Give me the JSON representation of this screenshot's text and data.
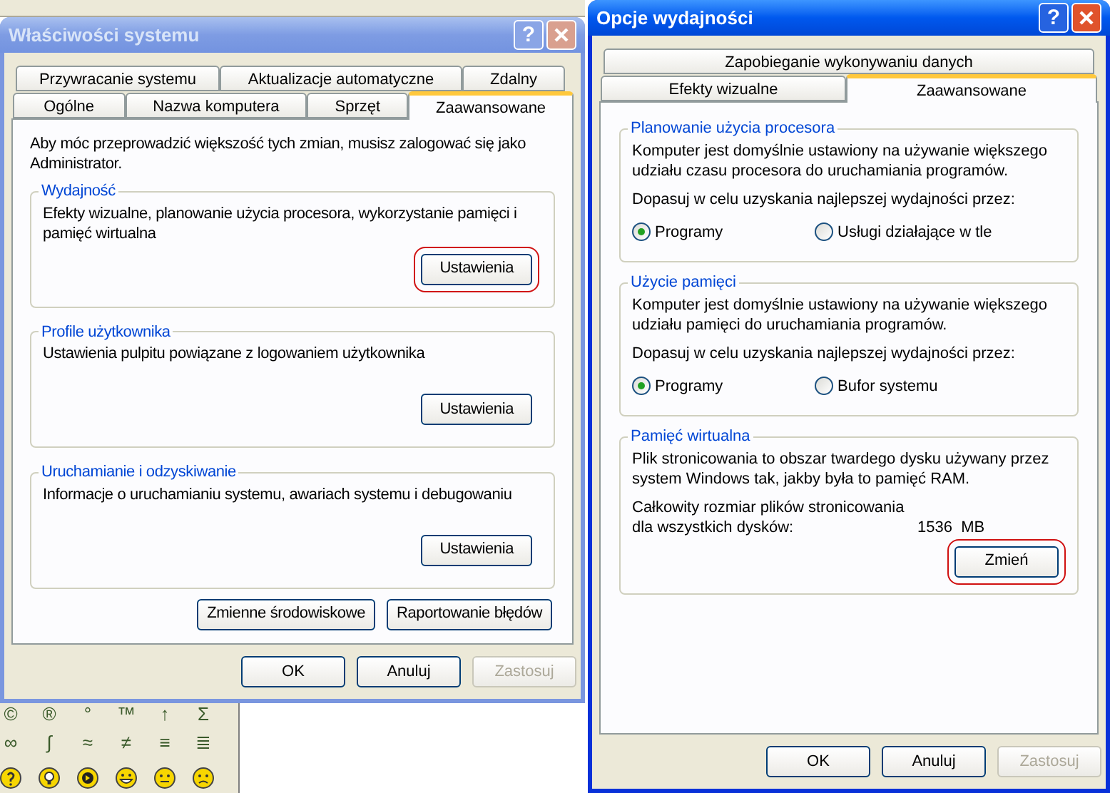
{
  "background": {
    "symbol_rows": [
      [
        "©",
        "®",
        "°",
        "™",
        "↑",
        "Σ"
      ],
      [
        "∞",
        "∫",
        "≈",
        "≠",
        "≡",
        "≣"
      ]
    ]
  },
  "system_properties": {
    "title": "Właściwości systemu",
    "active": false,
    "help": "?",
    "tab_rows": [
      [
        {
          "label": "Przywracanie systemu",
          "selected": false
        },
        {
          "label": "Aktualizacje automatyczne",
          "selected": false
        },
        {
          "label": "Zdalny",
          "selected": false
        }
      ],
      [
        {
          "label": "Ogólne",
          "selected": false
        },
        {
          "label": "Nazwa komputera",
          "selected": false
        },
        {
          "label": "Sprzęt",
          "selected": false
        },
        {
          "label": "Zaawansowane",
          "selected": true
        }
      ]
    ],
    "intro": "Aby móc przeprowadzić większość tych zmian, musisz zalogować się jako Administrator.",
    "groups": [
      {
        "title": "Wydajność",
        "text": "Efekty wizualne, planowanie użycia procesora, wykorzystanie pamięci i pamięć wirtualna",
        "button": {
          "label": "Ustawienia",
          "highlighted": true
        }
      },
      {
        "title": "Profile użytkownika",
        "text": "Ustawienia pulpitu powiązane z logowaniem użytkownika",
        "button": {
          "label": "Ustawienia",
          "highlighted": false
        }
      },
      {
        "title": "Uruchamianie i odzyskiwanie",
        "text": "Informacje o uruchamianiu systemu, awariach systemu i debugowaniu",
        "button": {
          "label": "Ustawienia",
          "highlighted": false
        }
      }
    ],
    "extra_buttons": [
      "Zmienne środowiskowe",
      "Raportowanie błędów"
    ],
    "footer_buttons": [
      {
        "label": "OK",
        "disabled": false
      },
      {
        "label": "Anuluj",
        "disabled": false
      },
      {
        "label": "Zastosuj",
        "disabled": true
      }
    ]
  },
  "performance_options": {
    "title": "Opcje wydajności",
    "active": true,
    "help": "?",
    "tab_rows": [
      [
        {
          "label": "Zapobieganie wykonywaniu danych",
          "selected": false
        }
      ],
      [
        {
          "label": "Efekty wizualne",
          "selected": false
        },
        {
          "label": "Zaawansowane",
          "selected": true
        }
      ]
    ],
    "groups": [
      {
        "kind": "radio",
        "title": "Planowanie użycia procesora",
        "text": "Komputer jest domyślnie ustawiony na używanie większego udziału czasu procesora do uruchamiania programów.",
        "prompt": "Dopasuj w celu uzyskania najlepszej wydajności przez:",
        "options": [
          {
            "label": "Programy",
            "selected": true
          },
          {
            "label": "Usługi działające w tle",
            "selected": false
          }
        ]
      },
      {
        "kind": "radio",
        "title": "Użycie pamięci",
        "text": "Komputer jest domyślnie ustawiony na używanie większego udziału pamięci do uruchamiania programów.",
        "prompt": "Dopasuj w celu uzyskania najlepszej wydajności przez:",
        "options": [
          {
            "label": "Programy",
            "selected": true
          },
          {
            "label": "Bufor systemu",
            "selected": false
          }
        ]
      },
      {
        "kind": "memory",
        "title": "Pamięć wirtualna",
        "text": "Plik stronicowania to obszar twardego dysku używany przez system Windows tak, jakby była to pamięć RAM.",
        "size_label": "Całkowity rozmiar plików stronicowania dla wszystkich dysków:",
        "size_value": "1536  MB",
        "button": {
          "label": "Zmień",
          "highlighted": true
        }
      }
    ],
    "footer_buttons": [
      {
        "label": "OK",
        "disabled": false
      },
      {
        "label": "Anuluj",
        "disabled": false
      },
      {
        "label": "Zastosuj",
        "disabled": true
      }
    ]
  }
}
